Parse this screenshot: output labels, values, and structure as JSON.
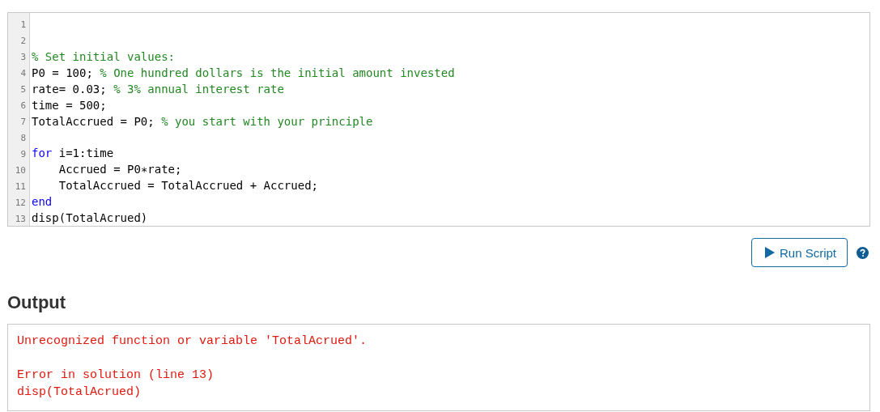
{
  "editor": {
    "lines": [
      {
        "number": "1"
      },
      {
        "number": "2"
      },
      {
        "number": "3",
        "segments": [
          {
            "kind": "comment",
            "text": "% Set initial values:"
          }
        ]
      },
      {
        "number": "4",
        "segments": [
          {
            "kind": "code",
            "text": "P0 = 100; "
          },
          {
            "kind": "comment",
            "text": "% One hundred dollars is the initial amount invested"
          }
        ]
      },
      {
        "number": "5",
        "segments": [
          {
            "kind": "code",
            "text": "rate= 0.03; "
          },
          {
            "kind": "comment",
            "text": "% 3% annual interest rate"
          }
        ]
      },
      {
        "number": "6",
        "segments": [
          {
            "kind": "code",
            "text": "time = 500;"
          }
        ]
      },
      {
        "number": "7",
        "segments": [
          {
            "kind": "code",
            "text": "TotalAccrued = P0; "
          },
          {
            "kind": "comment",
            "text": "% you start with your principle"
          }
        ]
      },
      {
        "number": "8"
      },
      {
        "number": "9",
        "segments": [
          {
            "kind": "keyword",
            "text": "for"
          },
          {
            "kind": "code",
            "text": " i=1:time"
          }
        ]
      },
      {
        "number": "10",
        "segments": [
          {
            "kind": "code",
            "text": "    Accrued = P0∗rate;"
          }
        ]
      },
      {
        "number": "11",
        "segments": [
          {
            "kind": "code",
            "text": "    TotalAccrued = TotalAccrued + Accrued;"
          }
        ]
      },
      {
        "number": "12",
        "segments": [
          {
            "kind": "keyword",
            "text": "end"
          }
        ]
      },
      {
        "number": "13",
        "segments": [
          {
            "kind": "code",
            "text": "disp(TotalAcrued)"
          }
        ]
      }
    ]
  },
  "run_button": {
    "label": "Run Script"
  },
  "output": {
    "heading": "Output",
    "messages": [
      {
        "lines": [
          "Unrecognized function or variable 'TotalAcrued'."
        ]
      },
      {
        "lines": [
          "Error in solution (line 13)",
          "disp(TotalAcrued)"
        ]
      }
    ]
  }
}
